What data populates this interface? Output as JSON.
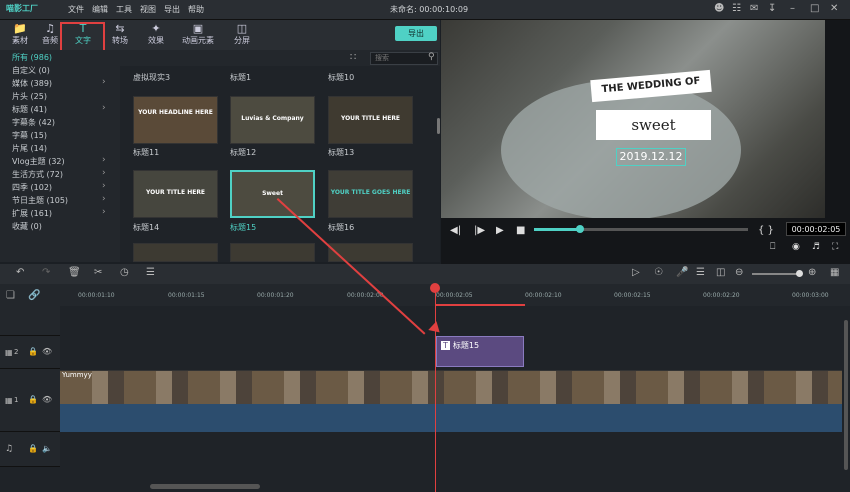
{
  "app": {
    "logo": "喵影工厂",
    "window_title": "未命名: 00:00:10:09"
  },
  "menu": [
    "文件",
    "编辑",
    "工具",
    "视图",
    "导出",
    "帮助"
  ],
  "window_icons": [
    "user-icon",
    "cart-icon",
    "mail-icon",
    "download-icon",
    "minimize-icon",
    "maximize-icon",
    "close-icon"
  ],
  "toolbar": [
    {
      "label": "素材",
      "icon": "folder-icon"
    },
    {
      "label": "音频",
      "icon": "music-icon"
    },
    {
      "label": "文字",
      "icon": "text-icon",
      "active": true
    },
    {
      "label": "转场",
      "icon": "transition-icon"
    },
    {
      "label": "效果",
      "icon": "effects-icon"
    },
    {
      "label": "动画元素",
      "icon": "image-icon"
    },
    {
      "label": "分屏",
      "icon": "split-icon"
    }
  ],
  "export_label": "导出",
  "search_placeholder": "搜索",
  "sidebar": [
    {
      "label": "所有 (986)",
      "arrow": false,
      "active": true
    },
    {
      "label": "自定义 (0)",
      "arrow": false
    },
    {
      "label": "媒体 (389)",
      "arrow": true
    },
    {
      "label": "片头 (25)",
      "arrow": false
    },
    {
      "label": "标题 (41)",
      "arrow": true
    },
    {
      "label": "字幕条 (42)",
      "arrow": false
    },
    {
      "label": "字幕 (15)",
      "arrow": false
    },
    {
      "label": "片尾 (14)",
      "arrow": false
    },
    {
      "label": "Vlog主题 (32)",
      "arrow": true
    },
    {
      "label": "生活方式 (72)",
      "arrow": true
    },
    {
      "label": "四季 (102)",
      "arrow": true
    },
    {
      "label": "节日主题 (105)",
      "arrow": true
    },
    {
      "label": "扩展 (161)",
      "arrow": true
    },
    {
      "label": "收藏 (0)",
      "arrow": false
    }
  ],
  "library": {
    "top_labels": [
      "虚拟现实3",
      "标题1",
      "标题10"
    ],
    "rows": [
      [
        {
          "label": "标题11",
          "text": "YOUR HEADLINE HERE"
        },
        {
          "label": "标题12",
          "text": "Luvias & Company"
        },
        {
          "label": "标题13",
          "text": "YOUR TITLE HERE"
        }
      ],
      [
        {
          "label": "标题14",
          "text": "YOUR TITLE HERE"
        },
        {
          "label": "标题15",
          "text": "Sweet",
          "selected": true
        },
        {
          "label": "标题16",
          "text": "YOUR TITLE GOES HERE"
        }
      ]
    ]
  },
  "preview": {
    "line1": "THE WEDDING OF",
    "line2": "sweet",
    "line3": "2019.12.12",
    "time": "00:00:02:05",
    "progress": 0.22
  },
  "ruler": [
    "00:00:01:10",
    "00:00:01:15",
    "00:00:01:20",
    "00:00:02:00",
    "00:00:02:05",
    "00:00:02:10",
    "00:00:02:15",
    "00:00:02:20",
    "00:00:03:00"
  ],
  "tracks": {
    "title_clip": "标题15",
    "video_clip": "Yummyy",
    "track2": "2",
    "track1": "1"
  }
}
